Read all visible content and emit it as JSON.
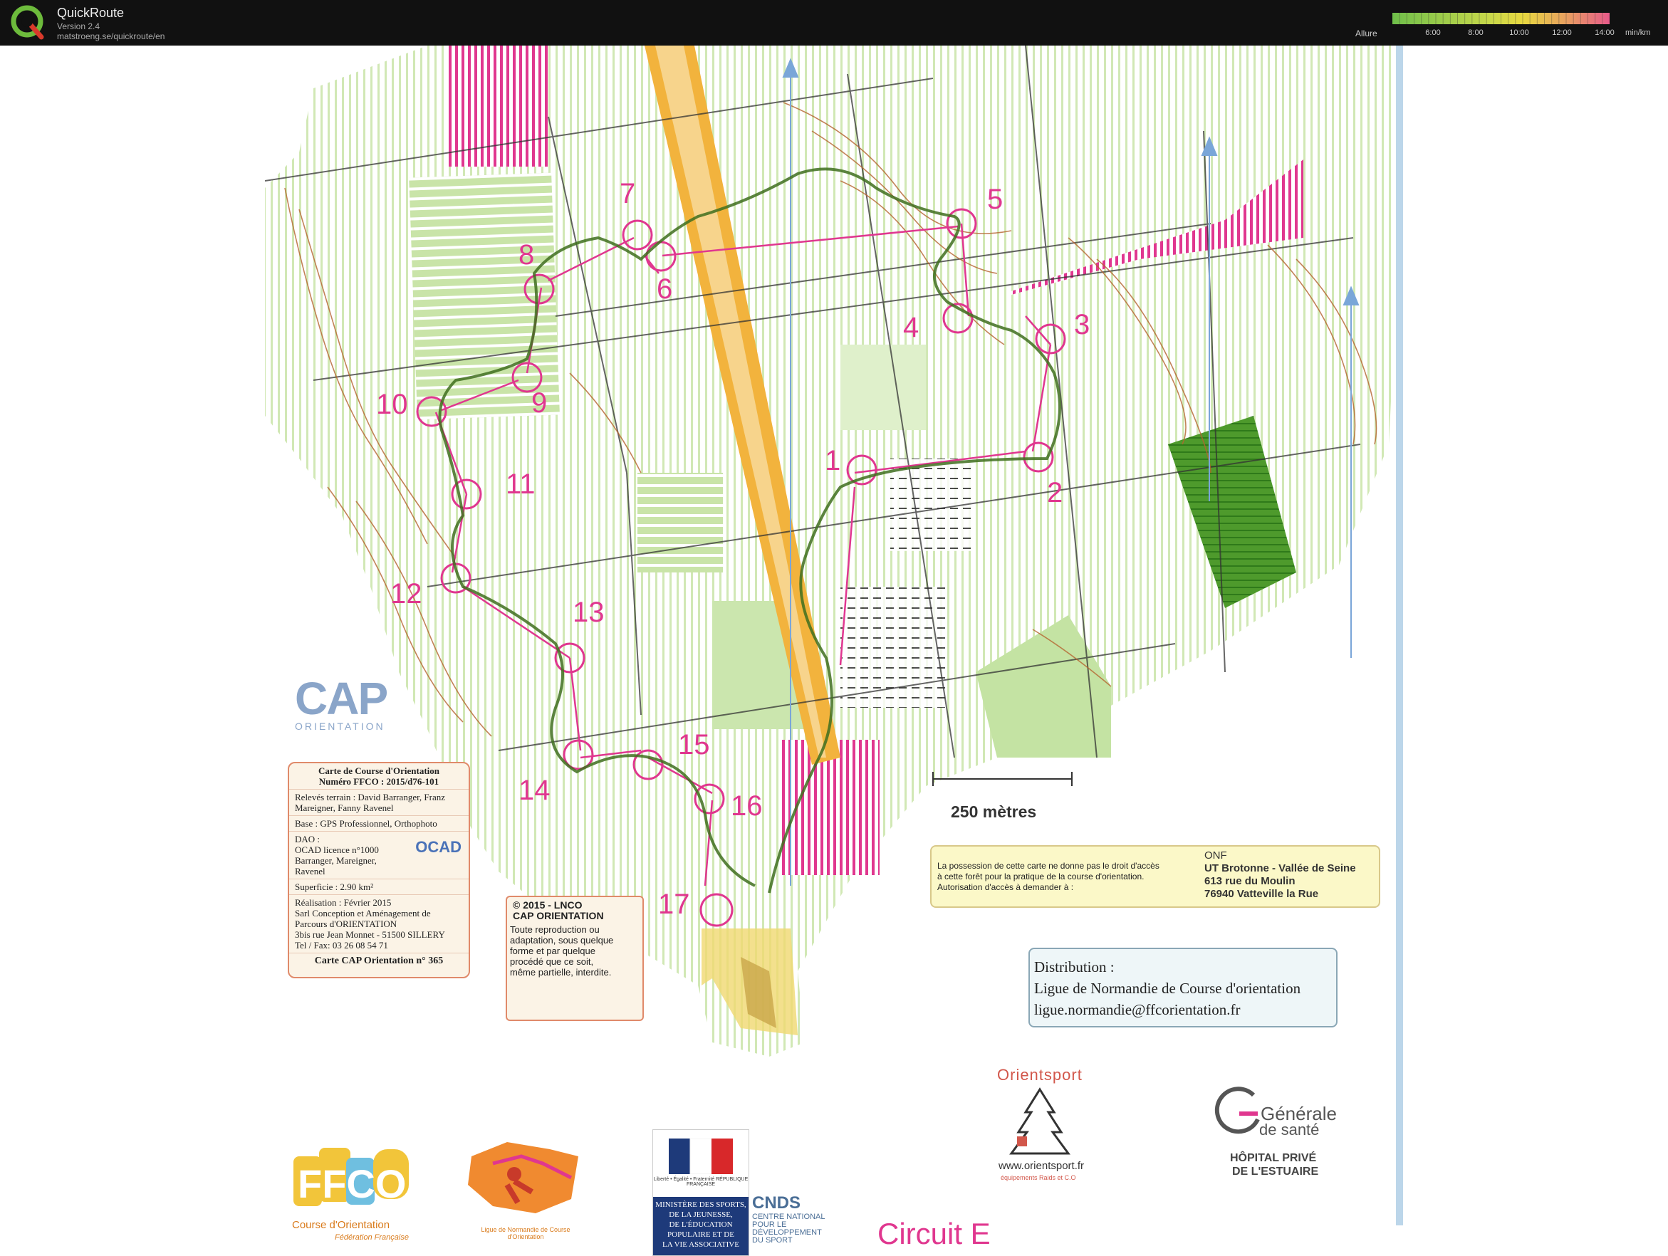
{
  "app": {
    "title": "QuickRoute",
    "version": "Version 2.4",
    "url": "matstroeng.se/quickroute/en"
  },
  "pace_scale": {
    "label": "Allure",
    "ticks": [
      "6:00",
      "8:00",
      "10:00",
      "12:00",
      "14:00"
    ],
    "unit": "min/km",
    "color_low": "#6fbf4a",
    "color_mid": "#e8d840",
    "color_high": "#e85a8a"
  },
  "map": {
    "controls": [
      "1",
      "2",
      "3",
      "4",
      "5",
      "6",
      "7",
      "8",
      "9",
      "10",
      "11",
      "12",
      "13",
      "14",
      "15",
      "16",
      "17"
    ],
    "scale": "250 mètres",
    "colors": {
      "course": "#e0378f",
      "route": "#3f6f1e",
      "vegetation": "#c9e4a8",
      "dark_green": "#4e9a2c",
      "road": "#f2b33d",
      "contour": "#b5642f"
    },
    "legend_card": {
      "title1": "Carte de Course d'Orientation",
      "title2": "Numéro FFCO : 2015/d76-101",
      "releves": "Relevés terrain : David Barranger, Franz Mareigner, Fanny Ravenel",
      "base": "Base : GPS Professionnel, Orthophoto",
      "dao_label": "DAO :",
      "dao_line1": "OCAD licence n°1000",
      "dao_line2": "Barranger, Mareigner,",
      "dao_line3": "Ravenel",
      "ocad": "OCAD",
      "superficie": "Superficie : 2.90 km²",
      "realisation": "Réalisation : Février 2015",
      "sarl1": "Sarl Conception et Aménagement de",
      "sarl2": "Parcours d'ORIENTATION",
      "address": "3bis rue Jean Monnet - 51500 SILLERY",
      "tel": "Tel / Fax: 03 26 08 54 71",
      "carte_num": "Carte CAP Orientation n° 365"
    },
    "cap_logo": {
      "name": "CAP",
      "sub": "ORIENTATION"
    },
    "copyright": {
      "line1": "© 2015 - LNCO",
      "line2": "CAP ORIENTATION",
      "body1": "Toute reproduction ou",
      "body2": "adaptation, sous quelque",
      "body3": "forme et par quelque",
      "body4": "procédé que ce soit,",
      "body5": "même partielle, interdite."
    },
    "onf": {
      "left1": "La possession de cette carte ne donne pas le droit d'accès",
      "left2": "à cette forêt pour la pratique de la course d'orientation.",
      "left3": "Autorisation d'accès à demander à :",
      "r1": "ONF",
      "r2": "UT Brotonne - Vallée de Seine",
      "r3": "613 rue du Moulin",
      "r4": "76940 Vatteville la Rue"
    },
    "distribution": {
      "line1": "Distribution :",
      "line2": "Ligue de Normandie de Course d'orientation",
      "line3": "ligue.normandie@ffcorientation.fr"
    },
    "circuit": "Circuit E",
    "sponsors": {
      "ffco_caption": "Course d'Orientation",
      "ffco_sub": "Fédération Française",
      "ligue_caption": "Ligue de Normandie de Course d'Orientation",
      "rf": "Liberté • Égalité • Fraternité RÉPUBLIQUE FRANÇAISE",
      "ministry1": "MINISTÈRE DES SPORTS,",
      "ministry2": "DE LA JEUNESSE,",
      "ministry3": "DE L'ÉDUCATION",
      "ministry4": "POPULAIRE ET DE",
      "ministry5": "LA VIE ASSOCIATIVE",
      "cnds": "CNDS",
      "cnds_text": "CENTRE NATIONAL POUR LE DÉVELOPPEMENT DU SPORT",
      "orientsport": "Orientsport",
      "orientsport_url": "www.orientsport.fr",
      "orientsport_sub": "équipements Raids et C.O",
      "gds1": "Générale",
      "gds2": "de santé",
      "gds3": "HÔPITAL PRIVÉ",
      "gds4": "DE L'ESTUAIRE"
    }
  }
}
